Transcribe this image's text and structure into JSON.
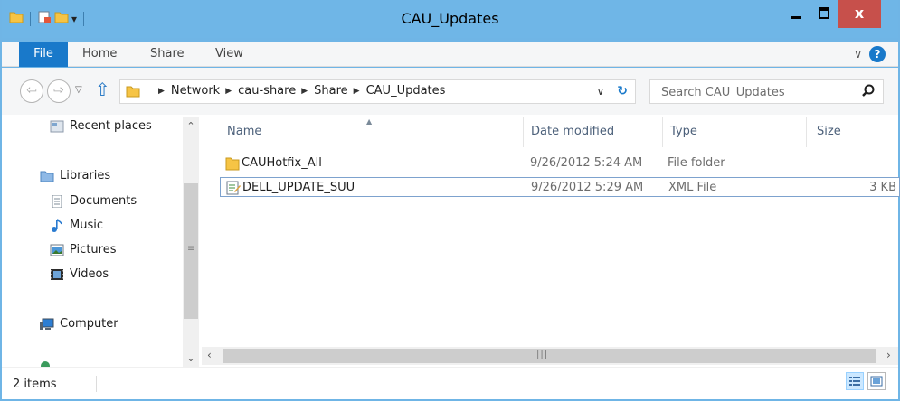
{
  "window": {
    "title": "CAU_Updates"
  },
  "title_controls": {
    "close_label": "x"
  },
  "ribbon": {
    "tabs": [
      {
        "label": "File"
      },
      {
        "label": "Home"
      },
      {
        "label": "Share"
      },
      {
        "label": "View"
      }
    ],
    "help_label": "?"
  },
  "navigation": {
    "breadcrumbs": [
      "Network",
      "cau-share",
      "Share",
      "CAU_Updates"
    ],
    "search_placeholder": "Search CAU_Updates"
  },
  "nav_pane": {
    "items": [
      {
        "label": "Recent places",
        "icon": "recent-places-icon"
      },
      {
        "label": "Libraries",
        "icon": "libraries-icon"
      },
      {
        "label": "Documents",
        "icon": "documents-icon"
      },
      {
        "label": "Music",
        "icon": "music-icon"
      },
      {
        "label": "Pictures",
        "icon": "pictures-icon"
      },
      {
        "label": "Videos",
        "icon": "videos-icon"
      },
      {
        "label": "Computer",
        "icon": "computer-icon"
      }
    ]
  },
  "file_list": {
    "columns": [
      "Name",
      "Date modified",
      "Type",
      "Size"
    ],
    "rows": [
      {
        "name": "CAUHotfix_All",
        "date": "9/26/2012 5:24 AM",
        "type": "File folder",
        "size": "",
        "icon": "folder-icon"
      },
      {
        "name": "DELL_UPDATE_SUU",
        "date": "9/26/2012 5:29 AM",
        "type": "XML File",
        "size": "3 KB",
        "icon": "xml-file-icon",
        "selected": true
      }
    ]
  },
  "status": {
    "item_count": "2 items"
  },
  "colors": {
    "title_bar": "#6fb6e7",
    "file_tab": "#1979ca",
    "close_button": "#c7504b",
    "selection_border": "#7da2ce"
  }
}
